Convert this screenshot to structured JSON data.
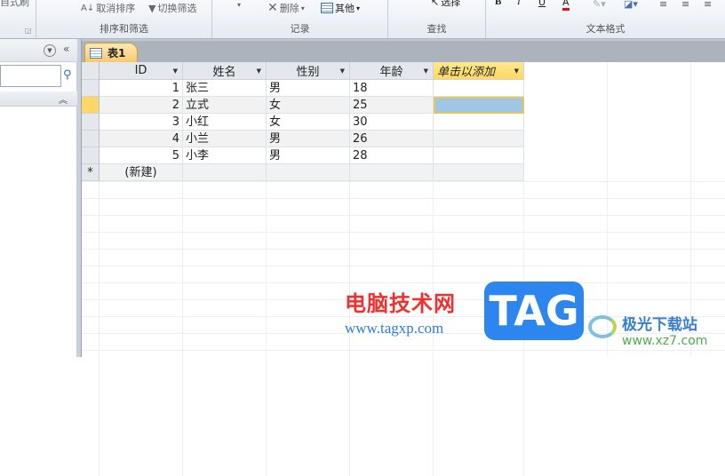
{
  "ribbon": {
    "groups": [
      {
        "label": "",
        "partial_text": "自式刷"
      },
      {
        "label": "排序和筛选",
        "buttons": [
          "取消排序",
          "切换筛选"
        ]
      },
      {
        "label": "记录",
        "buttons": [
          "删除",
          "其他"
        ]
      },
      {
        "label": "查找",
        "buttons": [
          "选择"
        ]
      },
      {
        "label": "文本格式",
        "buttons": [
          "B",
          "I",
          "U",
          "A"
        ]
      }
    ]
  },
  "colors": {
    "accent": "#f7c870",
    "selected_cell": "#9ec6e6",
    "font_color": "#e01010"
  },
  "table": {
    "tab_label": "表1",
    "columns": [
      "ID",
      "姓名",
      "性别",
      "年龄",
      "单击以添加"
    ],
    "rows": [
      [
        "1",
        "张三",
        "男",
        "18"
      ],
      [
        "2",
        "立式",
        "女",
        "25"
      ],
      [
        "3",
        "小红",
        "女",
        "30"
      ],
      [
        "4",
        "小兰",
        "男",
        "26"
      ],
      [
        "5",
        "小李",
        "男",
        "28"
      ]
    ],
    "new_row_label": "(新建)",
    "new_row_marker": "*"
  },
  "watermark": {
    "site_name": "电脑技术网",
    "site_url": "www.tagxp.com",
    "tag": "TAG",
    "brand2": "极光下载站",
    "brand2_url": "www.xz7.com"
  }
}
